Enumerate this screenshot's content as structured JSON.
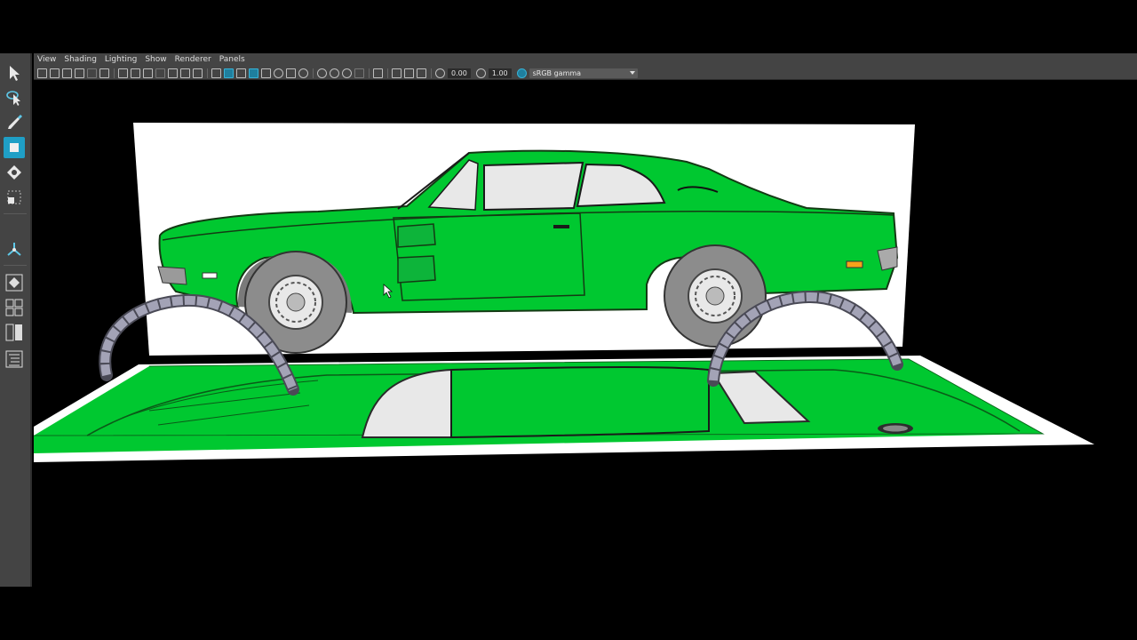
{
  "menubar": {
    "items": [
      "View",
      "Shading",
      "Lighting",
      "Show",
      "Renderer",
      "Panels"
    ]
  },
  "toolbar": {
    "exposure_value": "0.00",
    "gamma_value": "1.00",
    "color_space": "sRGB gamma"
  },
  "colors": {
    "car_green": "#00c830",
    "plane_white": "#ffffff",
    "ui_panel": "#444444",
    "ui_active": "#1f9fc6",
    "viewport_bg": "#000000"
  },
  "tools": [
    {
      "name": "select-tool-icon",
      "active": false
    },
    {
      "name": "lasso-tool-icon",
      "active": false
    },
    {
      "name": "paint-select-icon",
      "active": false
    },
    {
      "name": "move-tool-icon",
      "active": true
    },
    {
      "name": "rotate-tool-icon",
      "active": false
    },
    {
      "name": "scale-tool-icon",
      "active": false
    },
    {
      "name": "show-manipulator-icon",
      "active": false
    },
    {
      "name": "single-view-layout-icon",
      "active": false
    },
    {
      "name": "four-view-layout-icon",
      "active": false
    },
    {
      "name": "two-view-layout-icon",
      "active": false
    },
    {
      "name": "outliner-layout-icon",
      "active": false
    }
  ]
}
